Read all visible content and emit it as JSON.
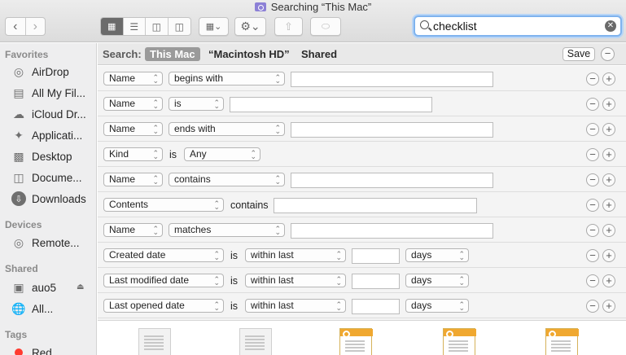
{
  "window": {
    "title": "Searching “This Mac”"
  },
  "toolbar": {
    "back_icon": "chevron-left-icon",
    "forward_icon": "chevron-right-icon"
  },
  "search": {
    "value": "checklist"
  },
  "sidebar": {
    "favorites_header": "Favorites",
    "favorites": [
      {
        "label": "AirDrop",
        "icon": "airdrop-icon"
      },
      {
        "label": "All My Fil...",
        "icon": "all-files-icon"
      },
      {
        "label": "iCloud Dr...",
        "icon": "cloud-icon"
      },
      {
        "label": "Applicati...",
        "icon": "applications-icon"
      },
      {
        "label": "Desktop",
        "icon": "desktop-icon"
      },
      {
        "label": "Docume...",
        "icon": "documents-icon"
      },
      {
        "label": "Downloads",
        "icon": "downloads-icon"
      }
    ],
    "devices_header": "Devices",
    "devices": [
      {
        "label": "Remote...",
        "icon": "disc-icon"
      }
    ],
    "shared_header": "Shared",
    "shared": [
      {
        "label": "auo5",
        "icon": "computer-icon"
      },
      {
        "label": "All...",
        "icon": "network-icon"
      }
    ],
    "tags_header": "Tags",
    "tags": [
      {
        "label": "Red",
        "color": "#ff3b30"
      }
    ]
  },
  "scope": {
    "label": "Search:",
    "this_mac": "This Mac",
    "macintosh_hd": "“Macintosh HD”",
    "shared": "Shared",
    "save": "Save"
  },
  "criteria": [
    {
      "attr": "Name",
      "op": "begins with"
    },
    {
      "attr": "Name",
      "op": "is"
    },
    {
      "attr": "Name",
      "op": "ends with"
    },
    {
      "attr": "Kind",
      "word": "is",
      "op": "Any"
    },
    {
      "attr": "Name",
      "op": "contains"
    },
    {
      "attr": "Contents",
      "word": "contains"
    },
    {
      "attr": "Name",
      "op": "matches"
    },
    {
      "attr": "Created date",
      "word": "is",
      "op": "within last",
      "unit": "days"
    },
    {
      "attr": "Last modified date",
      "word": "is",
      "op": "within last",
      "unit": "days"
    },
    {
      "attr": "Last opened date",
      "word": "is",
      "op": "within last",
      "unit": "days"
    }
  ]
}
